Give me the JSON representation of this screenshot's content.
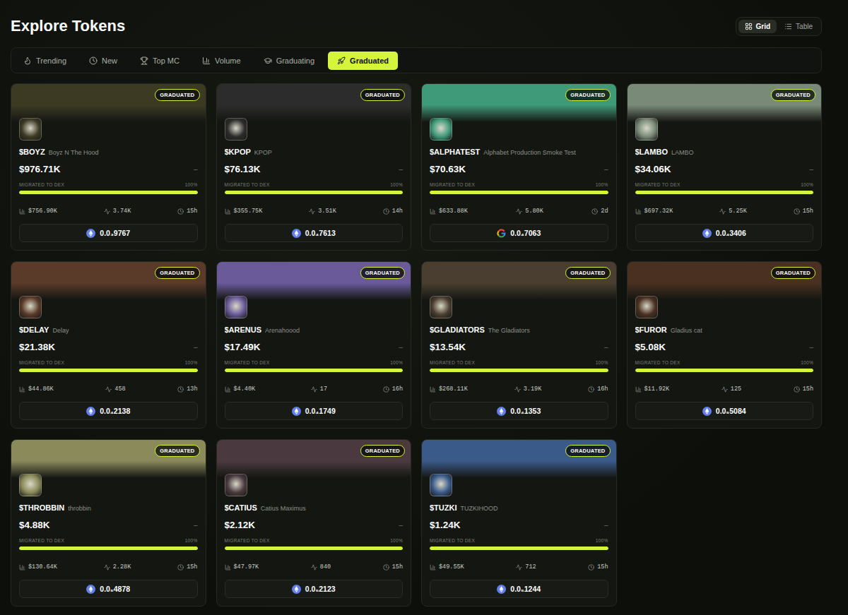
{
  "title": "Explore Tokens",
  "view_toggle": [
    {
      "label": "Grid",
      "selected": true
    },
    {
      "label": "Table",
      "selected": false
    }
  ],
  "filters": [
    {
      "label": "Trending",
      "selected": false
    },
    {
      "label": "New",
      "selected": false
    },
    {
      "label": "Top MC",
      "selected": false
    },
    {
      "label": "Volume",
      "selected": false
    },
    {
      "label": "Graduating",
      "selected": false
    },
    {
      "label": "Graduated",
      "selected": true
    }
  ],
  "tokens": [
    {
      "badge": "GRADUATED",
      "symbol": "$BOYZ",
      "name": "Boyz N The Hood",
      "market_cap": "$976.71K",
      "change": "–",
      "progress_label": "MIGRATED TO DEX",
      "progress_pct": "100%",
      "level": 1,
      "volume": "$756.90K",
      "txns": "3.74K",
      "age": "15h",
      "price": "0.0₃9767",
      "kind": "eth",
      "color": "#3d3a24"
    },
    {
      "badge": "GRADUATED",
      "symbol": "$KPOP",
      "name": "KPOP",
      "market_cap": "$76.13K",
      "change": "–",
      "progress_label": "MIGRATED TO DEX",
      "progress_pct": "100%",
      "level": 1,
      "volume": "$355.75K",
      "txns": "3.51K",
      "age": "14h",
      "price": "0.0₄7613",
      "kind": "eth",
      "color": "#2c2c2c"
    },
    {
      "badge": "GRADUATED",
      "symbol": "$ALPHATEST",
      "name": "Alphabet Production Smoke Test",
      "market_cap": "$70.63K",
      "change": "–",
      "progress_label": "MIGRATED TO DEX",
      "progress_pct": "100%",
      "level": 1,
      "volume": "$633.88K",
      "txns": "5.80K",
      "age": "2d",
      "price": "0.0₄7063",
      "kind": "google",
      "color": "#3f9a7a"
    },
    {
      "badge": "GRADUATED",
      "symbol": "$LAMBO",
      "name": "LAMBO",
      "market_cap": "$34.06K",
      "change": "–",
      "progress_label": "MIGRATED TO DEX",
      "progress_pct": "100%",
      "level": 1,
      "volume": "$697.32K",
      "txns": "5.25K",
      "age": "15h",
      "price": "0.0₄3406",
      "kind": "eth",
      "color": "#7a8a78"
    },
    {
      "badge": "GRADUATED",
      "symbol": "$DELAY",
      "name": "Delay",
      "market_cap": "$21.38K",
      "change": "–",
      "progress_label": "MIGRATED TO DEX",
      "progress_pct": "100%",
      "level": 1,
      "volume": "$44.86K",
      "txns": "458",
      "age": "13h",
      "price": "0.0₄2138",
      "kind": "eth",
      "color": "#5a3a28"
    },
    {
      "badge": "GRADUATED",
      "symbol": "$ARENUS",
      "name": "Arenahoood",
      "market_cap": "$17.49K",
      "change": "–",
      "progress_label": "MIGRATED TO DEX",
      "progress_pct": "100%",
      "level": 1,
      "volume": "$4.40K",
      "txns": "17",
      "age": "16h",
      "price": "0.0₄1749",
      "kind": "eth",
      "color": "#6a5a9a"
    },
    {
      "badge": "GRADUATED",
      "symbol": "$GLADIATORS",
      "name": "The Gladiators",
      "market_cap": "$13.54K",
      "change": "–",
      "progress_label": "MIGRATED TO DEX",
      "progress_pct": "100%",
      "level": 1,
      "volume": "$268.11K",
      "txns": "3.19K",
      "age": "16h",
      "price": "0.0₄1353",
      "kind": "eth",
      "color": "#4a3e30"
    },
    {
      "badge": "GRADUATED",
      "symbol": "$FUROR",
      "name": "Gladius cat",
      "market_cap": "$5.08K",
      "change": "–",
      "progress_label": "MIGRATED TO DEX",
      "progress_pct": "100%",
      "level": 1,
      "volume": "$11.92K",
      "txns": "125",
      "age": "15h",
      "price": "0.0₅5084",
      "kind": "eth",
      "color": "#4a3020"
    },
    {
      "badge": "GRADUATED",
      "symbol": "$THROBBIN",
      "name": "throbbin",
      "market_cap": "$4.88K",
      "change": "–",
      "progress_label": "MIGRATED TO DEX",
      "progress_pct": "100%",
      "level": 1,
      "volume": "$130.64K",
      "txns": "2.28K",
      "age": "15h",
      "price": "0.0₅4878",
      "kind": "eth",
      "color": "#8a8a5a"
    },
    {
      "badge": "GRADUATED",
      "symbol": "$CATIUS",
      "name": "Catius Maximus",
      "market_cap": "$2.12K",
      "change": "–",
      "progress_label": "MIGRATED TO DEX",
      "progress_pct": "100%",
      "level": 1,
      "volume": "$47.97K",
      "txns": "840",
      "age": "15h",
      "price": "0.0₅2123",
      "kind": "eth",
      "color": "#4a3a40"
    },
    {
      "badge": "GRADUATED",
      "symbol": "$TUZKI",
      "name": "TUZKIHOOD",
      "market_cap": "$1.24K",
      "change": "–",
      "progress_label": "MIGRATED TO DEX",
      "progress_pct": "100%",
      "level": 1,
      "volume": "$49.55K",
      "txns": "712",
      "age": "15h",
      "price": "0.0₅1244",
      "kind": "eth",
      "color": "#3a5a8a"
    }
  ]
}
